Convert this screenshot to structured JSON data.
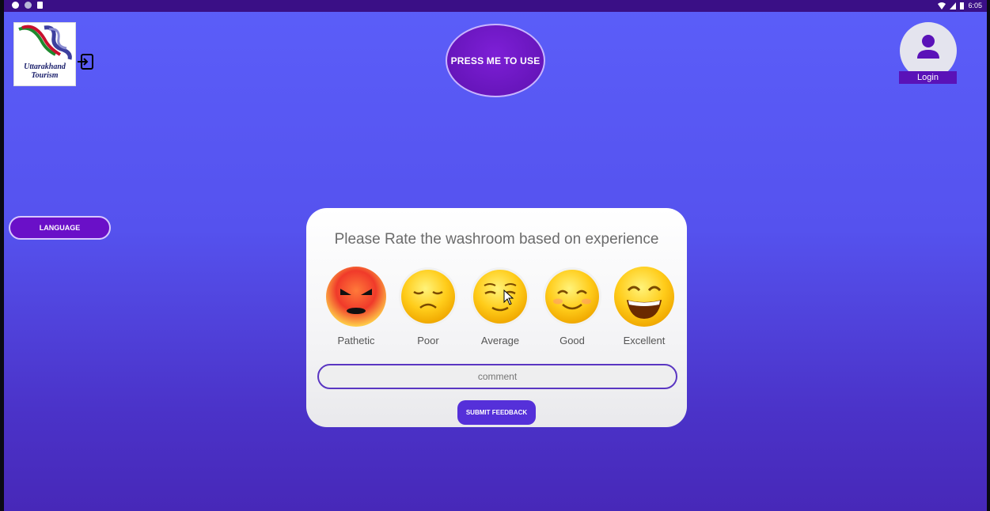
{
  "status_bar": {
    "time": "6:05"
  },
  "logo": {
    "line1": "Uttarakhand",
    "line2": "Tourism"
  },
  "header": {
    "press_button": "PRESS ME TO USE",
    "login_label": "Login"
  },
  "sidebar": {
    "language_button": "LANGUAGE"
  },
  "feedback": {
    "title": "Please Rate the washroom based on experience",
    "ratings": [
      {
        "label": "Pathetic",
        "icon": "angry-face-icon"
      },
      {
        "label": "Poor",
        "icon": "disappointed-face-icon"
      },
      {
        "label": "Average",
        "icon": "relieved-face-icon"
      },
      {
        "label": "Good",
        "icon": "smiling-face-icon"
      },
      {
        "label": "Excellent",
        "icon": "grinning-face-icon"
      }
    ],
    "comment_placeholder": "comment",
    "submit_label": "SUBMIT FEEDBACK"
  },
  "colors": {
    "accent": "#5a12b8",
    "background": "#5b5ef9",
    "card": "#ffffff"
  }
}
